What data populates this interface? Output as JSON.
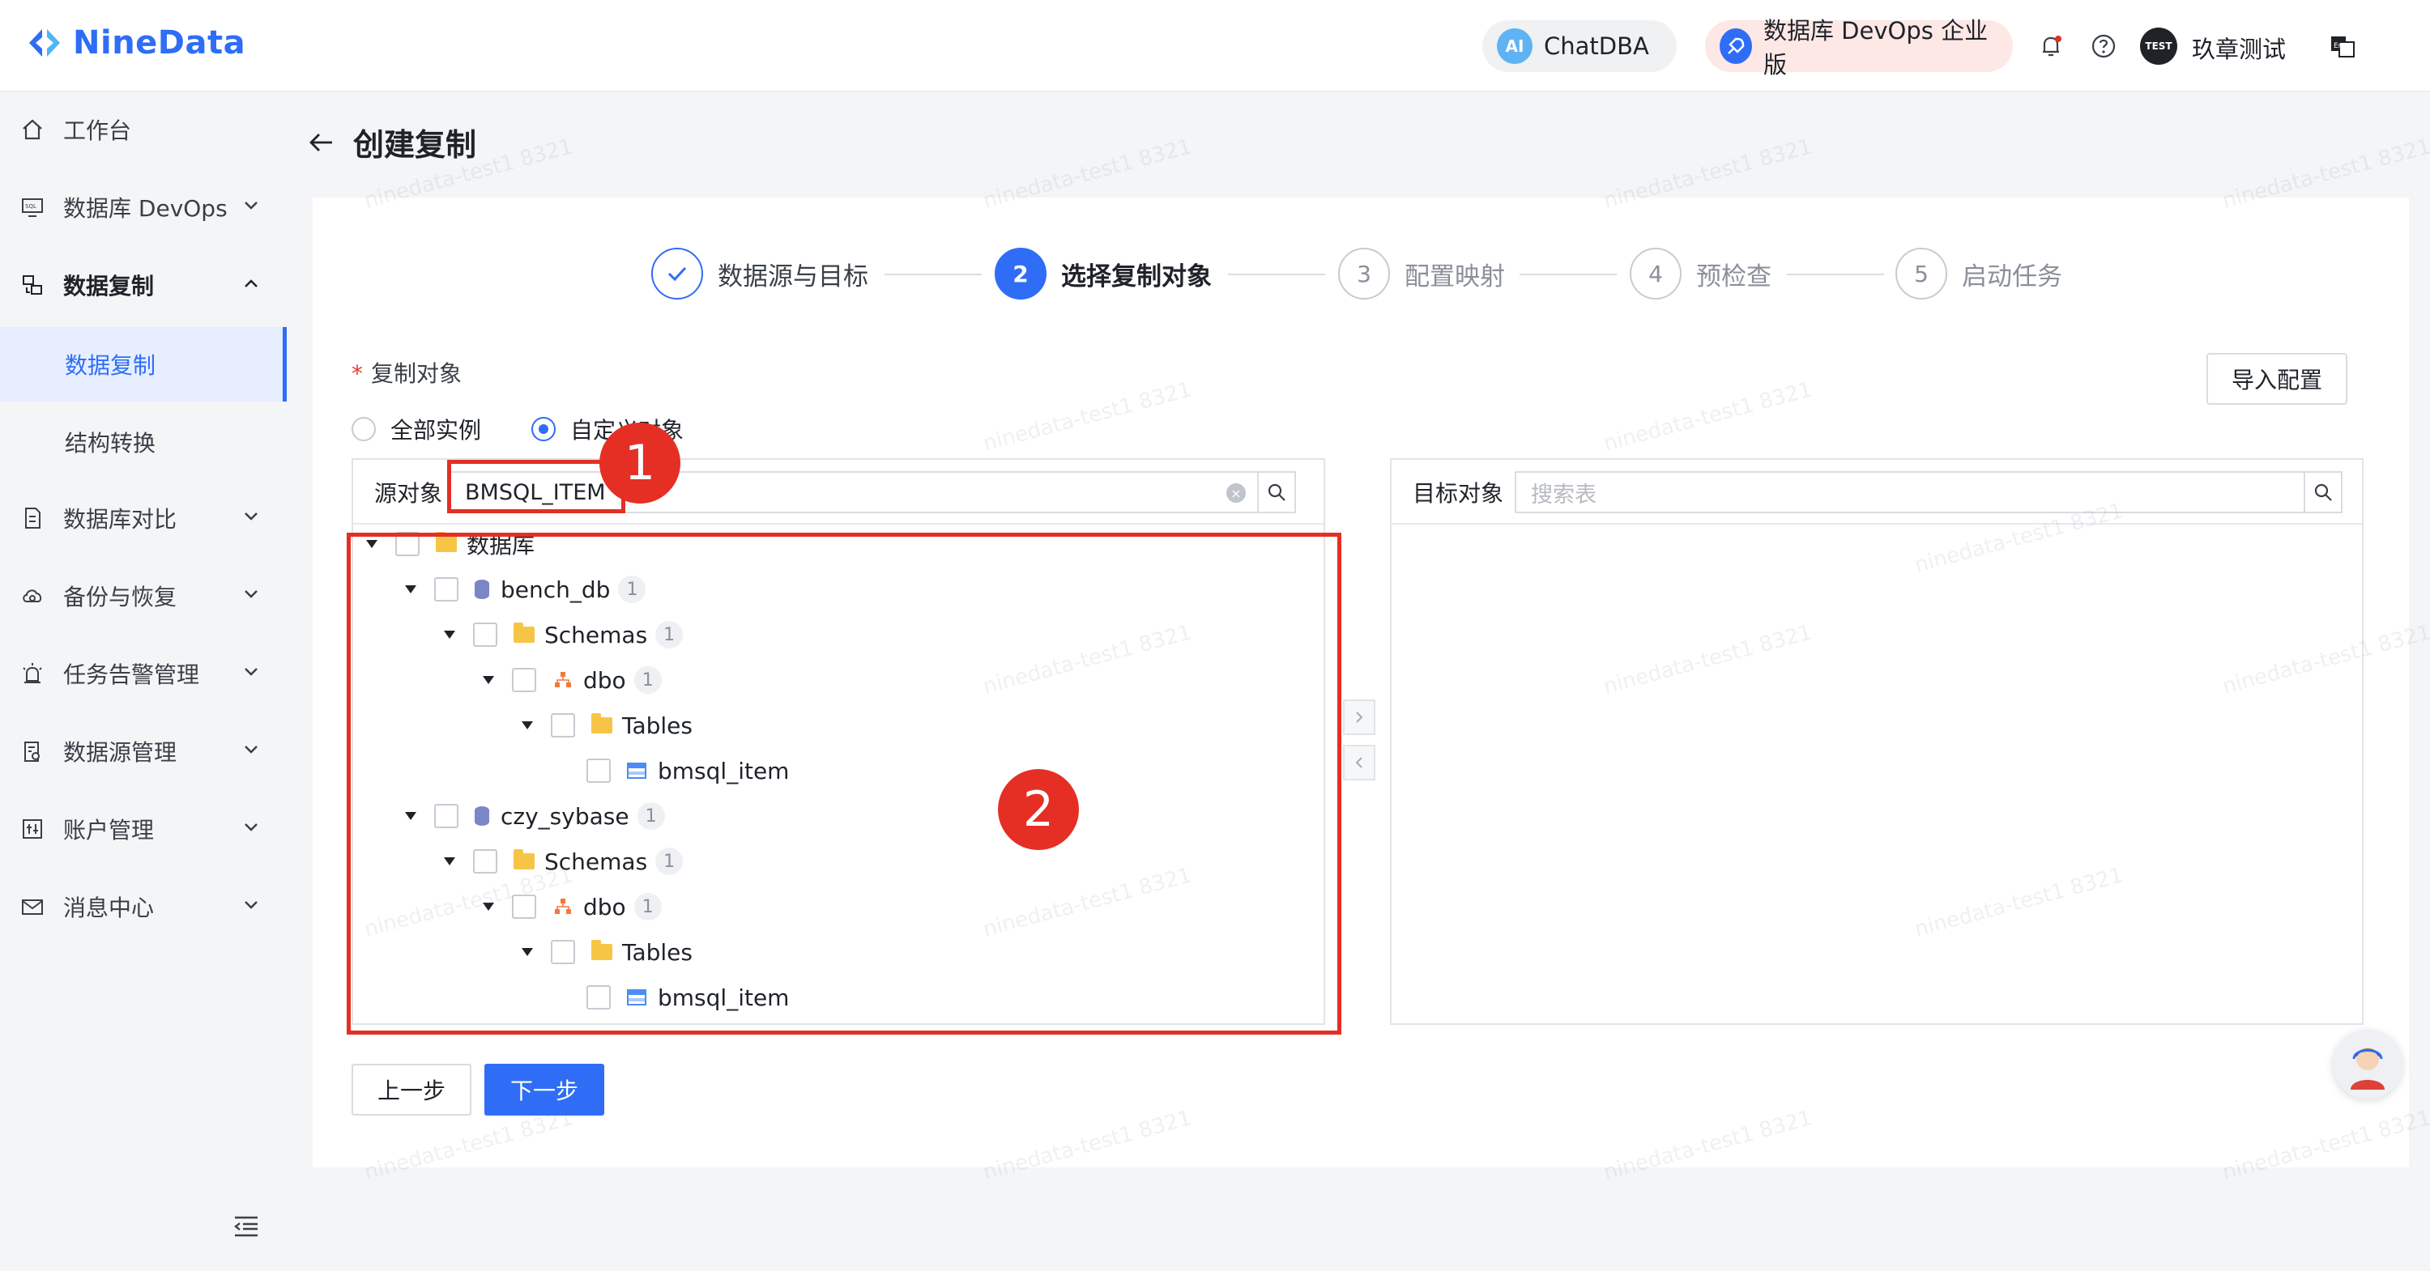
{
  "header": {
    "logo_text": "NineData",
    "chatdba_label": "ChatDBA",
    "chatdba_badge": "AI",
    "devops_label": "数据库 DevOps 企业版",
    "avatar_text": "TEST",
    "username": "玖章测试"
  },
  "sidebar": {
    "items": [
      {
        "label": "工作台",
        "icon": "home-icon"
      },
      {
        "label": "数据库 DevOps",
        "icon": "sql-icon"
      },
      {
        "label": "数据复制",
        "icon": "replicate-icon"
      },
      {
        "label": "数据复制"
      },
      {
        "label": "结构转换"
      },
      {
        "label": "数据库对比",
        "icon": "compare-icon"
      },
      {
        "label": "备份与恢复",
        "icon": "backup-icon"
      },
      {
        "label": "任务告警管理",
        "icon": "alarm-icon"
      },
      {
        "label": "数据源管理",
        "icon": "datasource-icon"
      },
      {
        "label": "账户管理",
        "icon": "account-icon"
      },
      {
        "label": "消息中心",
        "icon": "mail-icon"
      }
    ]
  },
  "page": {
    "title": "创建复制",
    "steps": [
      {
        "num": "✓",
        "label": "数据源与目标"
      },
      {
        "num": "2",
        "label": "选择复制对象"
      },
      {
        "num": "3",
        "label": "配置映射"
      },
      {
        "num": "4",
        "label": "预检查"
      },
      {
        "num": "5",
        "label": "启动任务"
      }
    ],
    "field_required_mark": "*",
    "field_label": "复制对象",
    "import_button": "导入配置",
    "radio_all": "全部实例",
    "radio_custom": "自定义对象",
    "source": {
      "label": "源对象",
      "search_value": "BMSQL_ITEM"
    },
    "target": {
      "label": "目标对象",
      "search_placeholder": "搜索表"
    },
    "tree": [
      {
        "label": "数据库",
        "type": "folder",
        "badge": ""
      },
      {
        "label": "bench_db",
        "type": "db",
        "badge": "1"
      },
      {
        "label": "Schemas",
        "type": "folder",
        "badge": "1"
      },
      {
        "label": "dbo",
        "type": "schema",
        "badge": "1"
      },
      {
        "label": "Tables",
        "type": "folder",
        "badge": ""
      },
      {
        "label": "bmsql_item",
        "type": "table",
        "badge": ""
      },
      {
        "label": "czy_sybase",
        "type": "db",
        "badge": "1"
      },
      {
        "label": "Schemas",
        "type": "folder",
        "badge": "1"
      },
      {
        "label": "dbo",
        "type": "schema",
        "badge": "1"
      },
      {
        "label": "Tables",
        "type": "folder",
        "badge": ""
      },
      {
        "label": "bmsql_item",
        "type": "table",
        "badge": ""
      }
    ],
    "prev_button": "上一步",
    "next_button": "下一步"
  },
  "annotations": {
    "marker_1": "1",
    "marker_2": "2"
  },
  "watermark_text": "ninedata-test1 8321",
  "colors": {
    "primary": "#2f6df6",
    "annotation": "#e52f25",
    "sidebar_bg": "#f4f5f7"
  }
}
